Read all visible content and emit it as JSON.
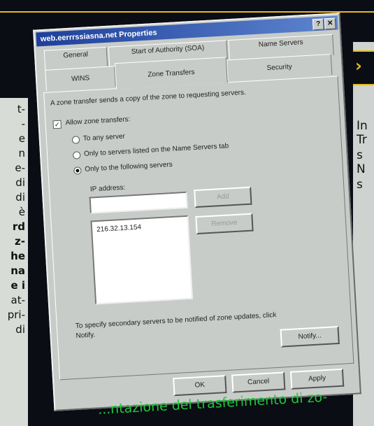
{
  "window": {
    "title": "web.eerrrssiasna.net Properties",
    "help_label": "?",
    "close_label": "✕"
  },
  "tabs": [
    {
      "label": "General"
    },
    {
      "label": "Start of Authority (SOA)"
    },
    {
      "label": "Name Servers"
    },
    {
      "label": "WINS"
    },
    {
      "label": "Zone Transfers"
    },
    {
      "label": "Security"
    }
  ],
  "zone": {
    "description": "A zone transfer sends a copy of the zone to requesting servers.",
    "allow_label": "Allow zone transfers:",
    "allow_checked": true,
    "options": [
      {
        "label": "To any server",
        "selected": false
      },
      {
        "label": "Only to servers listed on the Name Servers tab",
        "selected": false
      },
      {
        "label": "Only to the following servers",
        "selected": true
      }
    ],
    "ip_label": "IP address:",
    "ip_input_value": "",
    "add_label": "Add",
    "remove_label": "Remove",
    "ip_list": [
      "216.32.13.154"
    ],
    "notify_text_1": "To specify secondary servers to be notified of zone updates, click",
    "notify_text_2": "Notify.",
    "notify_label": "Notify..."
  },
  "footer": {
    "ok_label": "OK",
    "cancel_label": "Cancel",
    "apply_label": "Apply"
  },
  "left_text": [
    {
      "text": "t-",
      "bold": false
    },
    {
      "text": "-",
      "bold": false
    },
    {
      "text": "e",
      "bold": false
    },
    {
      "text": "n",
      "bold": false
    },
    {
      "text": "e-",
      "bold": false
    },
    {
      "text": "di",
      "bold": false
    },
    {
      "text": "di",
      "bold": false
    },
    {
      "text": "è",
      "bold": false
    },
    {
      "text": "rd",
      "bold": true
    },
    {
      "text": "z-",
      "bold": true
    },
    {
      "text": "he",
      "bold": true
    },
    {
      "text": "na",
      "bold": true
    },
    {
      "text": "e i",
      "bold": true
    },
    {
      "text": "at-",
      "bold": false
    },
    {
      "text": "pri-",
      "bold": false
    },
    {
      "text": "di",
      "bold": false
    }
  ],
  "right_text": [
    "In",
    "Tr",
    "s",
    "N",
    "s"
  ],
  "right_header_symbol": "›",
  "caption": "...ntazione del trasferimento di zo-"
}
